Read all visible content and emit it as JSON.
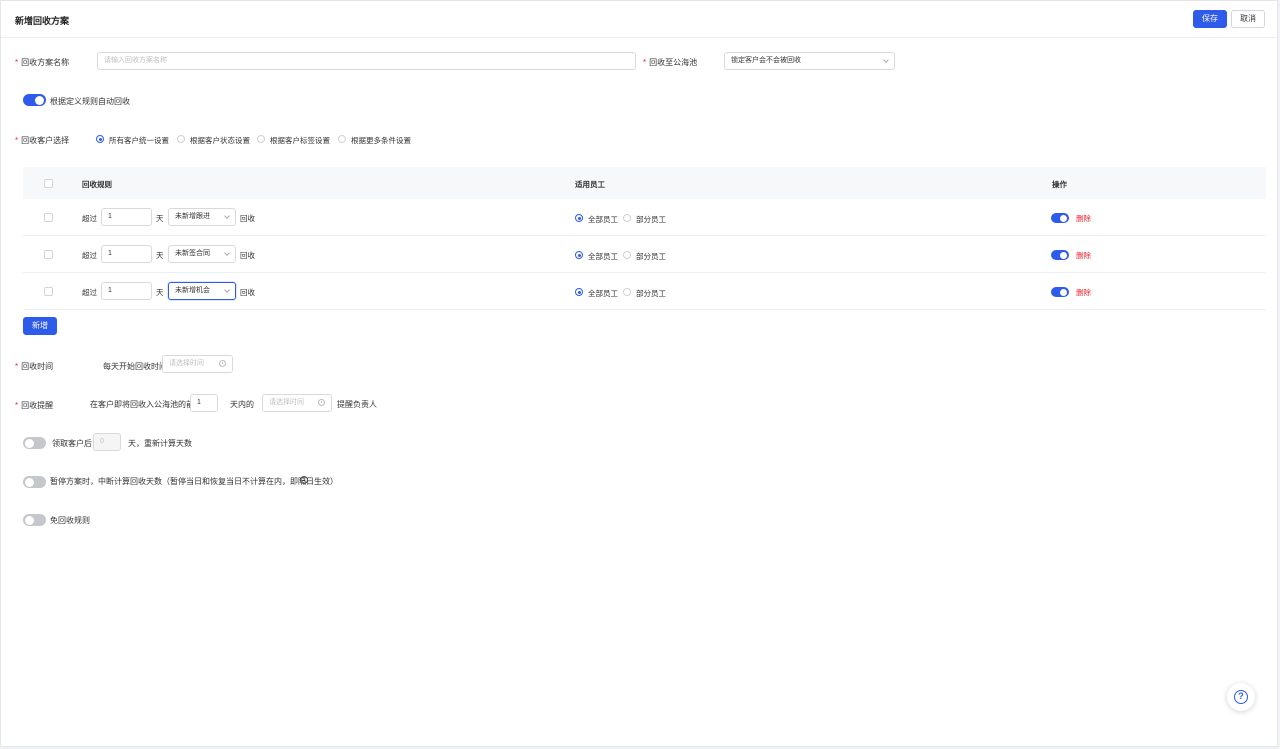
{
  "header": {
    "title": "新增回收方案",
    "save_label": "保存",
    "cancel_label": "取消"
  },
  "form": {
    "plan_name": {
      "label": "回收方案名称",
      "placeholder": "请输入回收方案名称"
    },
    "pool": {
      "label": "回收至公海池",
      "value": "锁定客户会不会被回收"
    },
    "auto_recycle_label": "根据定义规则自动回收",
    "customer_select": {
      "label": "回收客户选择",
      "options": [
        "所有客户统一设置",
        "根据客户状态设置",
        "根据客户标签设置",
        "根据更多条件设置"
      ],
      "selected_index": 0
    },
    "table": {
      "headers": {
        "rule": "回收规则",
        "staff": "适用员工",
        "action": "操作"
      },
      "rows": [
        {
          "prefix": "超过",
          "days": "1",
          "unit": "天",
          "condition": "未新增跟进",
          "suffix": "回收",
          "staff_all": "全部员工",
          "staff_part": "部分员工",
          "enabled": true,
          "delete_label": "删除"
        },
        {
          "prefix": "超过",
          "days": "1",
          "unit": "天",
          "condition": "未新签合同",
          "suffix": "回收",
          "staff_all": "全部员工",
          "staff_part": "部分员工",
          "enabled": true,
          "delete_label": "删除"
        },
        {
          "prefix": "超过",
          "days": "1",
          "unit": "天",
          "condition": "未新增机会",
          "suffix": "回收",
          "staff_all": "全部员工",
          "staff_part": "部分员工",
          "enabled": true,
          "delete_label": "删除"
        }
      ]
    },
    "add_label": "新增",
    "recycle_time": {
      "label": "回收时间",
      "prefix": "每天开始回收时间",
      "placeholder": "请选择时间"
    },
    "reminder": {
      "label": "回收提醒",
      "prefix": "在客户即将回收入公海池的前",
      "days": "1",
      "middle": "天内的",
      "placeholder": "请选择时间",
      "suffix": "提醒负责人"
    },
    "claim": {
      "prefix": "领取客户后",
      "days": "0",
      "suffix": "天，重新计算天数"
    },
    "pause_label": "暂停方案时，中断计算回收天数（暂停当日和恢复当日不计算在内，即隔日生效）",
    "exempt_label": "免回收规则"
  },
  "colors": {
    "primary": "#2e5bea",
    "danger": "#f5222d"
  }
}
